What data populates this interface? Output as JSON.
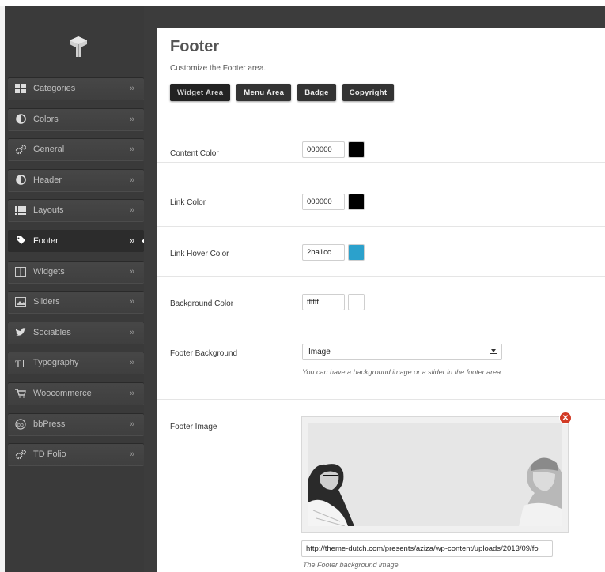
{
  "sidebar": {
    "items": [
      {
        "label": "Categories",
        "icon": "grid-icon"
      },
      {
        "label": "Colors",
        "icon": "contrast-icon"
      },
      {
        "label": "General",
        "icon": "gears-icon"
      },
      {
        "label": "Header",
        "icon": "contrast-icon"
      },
      {
        "label": "Layouts",
        "icon": "list-icon"
      },
      {
        "label": "Footer",
        "icon": "tag-icon"
      },
      {
        "label": "Widgets",
        "icon": "columns-icon"
      },
      {
        "label": "Sliders",
        "icon": "image-icon"
      },
      {
        "label": "Sociables",
        "icon": "twitter-icon"
      },
      {
        "label": "Typography",
        "icon": "text-icon"
      },
      {
        "label": "Woocommerce",
        "icon": "cart-icon"
      },
      {
        "label": "bbPress",
        "icon": "bbpress-icon"
      },
      {
        "label": "TD Folio",
        "icon": "gears-icon"
      }
    ],
    "active_index": 5,
    "arrow": "»"
  },
  "main": {
    "title": "Footer",
    "description": "Customize the Footer area.",
    "tabs": [
      {
        "label": "Widget Area",
        "active": true
      },
      {
        "label": "Menu Area"
      },
      {
        "label": "Badge"
      },
      {
        "label": "Copyright"
      }
    ],
    "fields": {
      "content_color": {
        "label": "Content Color",
        "value": "000000",
        "color": "#000000"
      },
      "link_color": {
        "label": "Link Color",
        "value": "000000",
        "color": "#000000"
      },
      "link_hover_color": {
        "label": "Link Hover Color",
        "value": "2ba1cc",
        "color": "#2ba1cc"
      },
      "background_color": {
        "label": "Background Color",
        "value": "ffffff",
        "color": "#ffffff"
      },
      "footer_background": {
        "label": "Footer Background",
        "selected": "Image",
        "help": "You can have a background image or a slider in the footer area."
      },
      "footer_image": {
        "label": "Footer Image",
        "url": "http://theme-dutch.com/presents/aziza/wp-content/uploads/2013/09/fo",
        "help": "The Footer background image."
      }
    }
  }
}
